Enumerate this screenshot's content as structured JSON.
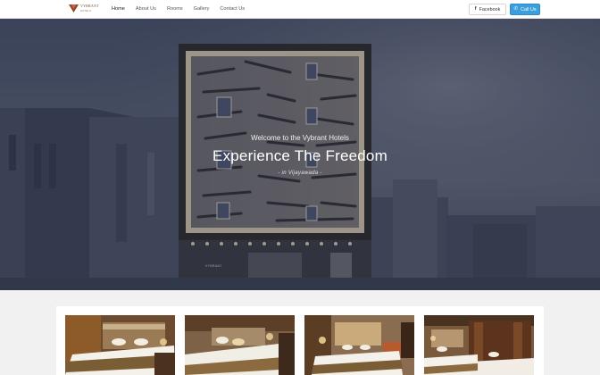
{
  "brand": {
    "name": "VYBRANT",
    "tagline": "HOTELS",
    "logo_color": "#8a4b1f"
  },
  "nav": {
    "items": [
      {
        "label": "Home",
        "active": true
      },
      {
        "label": "About Us",
        "active": false
      },
      {
        "label": "Rooms",
        "active": false
      },
      {
        "label": "Gallery",
        "active": false
      },
      {
        "label": "Contact Us",
        "active": false
      }
    ]
  },
  "actions": {
    "facebook": {
      "label": "Facebook",
      "icon": "facebook-icon"
    },
    "call": {
      "label": "Call Us",
      "icon": "phone-icon",
      "color": "#3a9fdc"
    }
  },
  "hero": {
    "subtitle": "Welcome to the Vybrant Hotels",
    "title": "Experience The Freedom",
    "location": "- in Vijayawada -",
    "building_sign": "VYBRANT"
  },
  "rooms": [
    {
      "name": "room-photo-1"
    },
    {
      "name": "room-photo-2"
    },
    {
      "name": "room-photo-3"
    },
    {
      "name": "room-photo-4"
    }
  ]
}
